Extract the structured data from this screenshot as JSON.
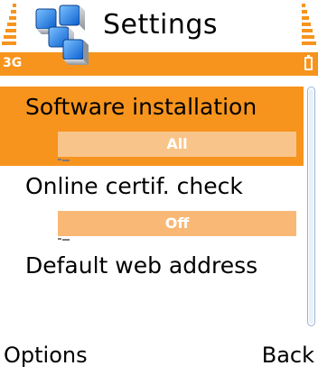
{
  "status_bar": {
    "network": "3G",
    "signal_level": 1.0,
    "battery_level": 1.0
  },
  "header": {
    "title": "Settings",
    "app_icon": "settings-grid-icon"
  },
  "settings_list": {
    "items": [
      {
        "label": "Software installation",
        "value": "All",
        "selected": true
      },
      {
        "label": "Online certif. check",
        "value": "Off",
        "selected": false
      },
      {
        "label": "Default web address",
        "value": "",
        "selected": false
      }
    ]
  },
  "softkeys": {
    "left": "Options",
    "right": "Back"
  },
  "colors": {
    "accent": "#f7941d",
    "value_bar": "#f9b876",
    "scrollbar_border": "#9ab3d5"
  }
}
